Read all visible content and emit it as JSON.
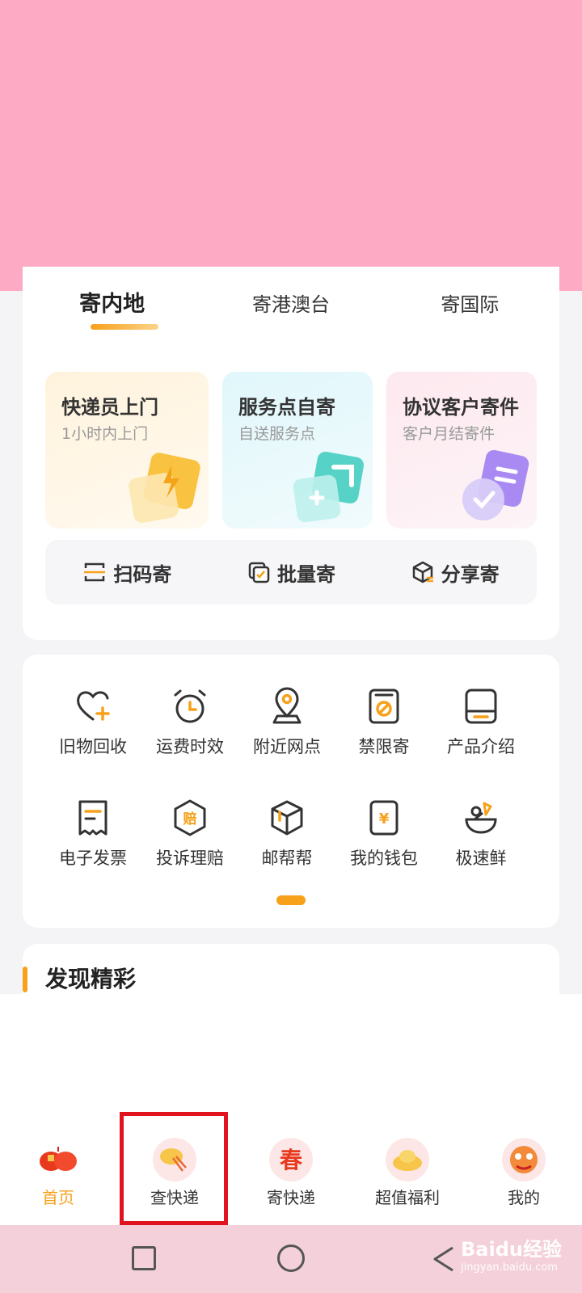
{
  "tabs": [
    "寄内地",
    "寄港澳台",
    "寄国际"
  ],
  "services": [
    {
      "title": "快递员上门",
      "subtitle": "1小时内上门"
    },
    {
      "title": "服务点自寄",
      "subtitle": "自送服务点"
    },
    {
      "title": "协议客户寄件",
      "subtitle": "客户月结寄件"
    }
  ],
  "quick_actions": [
    "扫码寄",
    "批量寄",
    "分享寄"
  ],
  "tools": [
    "旧物回收",
    "运费时效",
    "附近网点",
    "禁限寄",
    "产品介绍",
    "电子发票",
    "投诉理赔",
    "邮帮帮",
    "我的钱包",
    "极速鲜"
  ],
  "discover_title": "发现精彩",
  "bottom_nav": [
    "首页",
    "查快递",
    "寄快递",
    "超值福利",
    "我的"
  ],
  "active_nav": "首页",
  "watermark": {
    "brand": "Baidu经验",
    "url": "jingyan.baidu.com"
  },
  "colors": {
    "accent": "#f7a11a",
    "banner": "#fdaac5",
    "highlight": "#e0141e"
  }
}
